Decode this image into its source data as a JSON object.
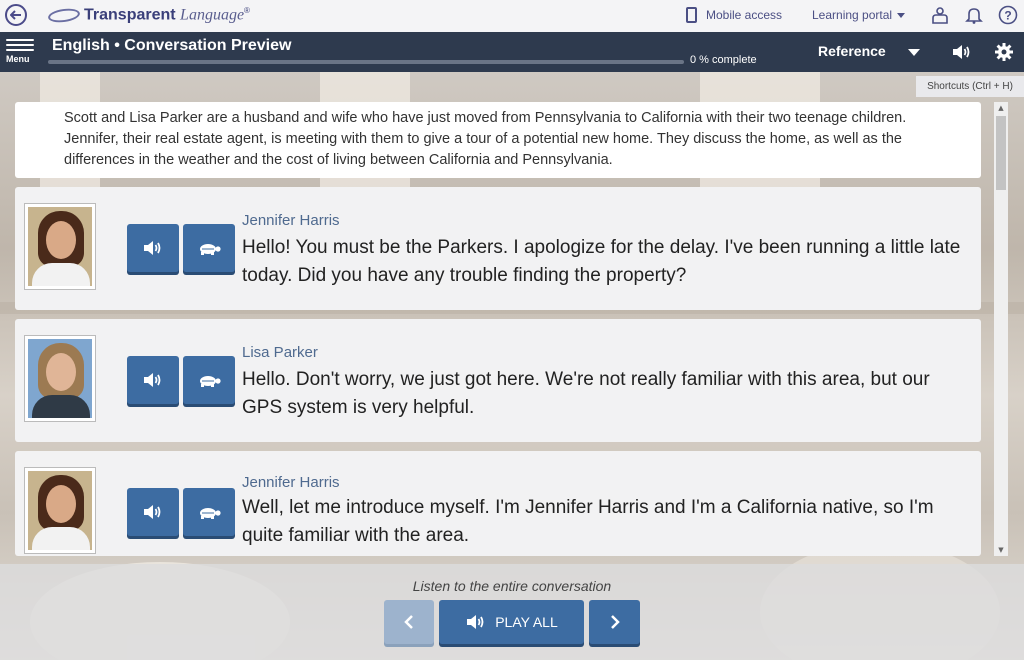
{
  "topbar": {
    "back_icon": "back-arrow-icon",
    "logo_brand": "Transparent",
    "logo_word": "Language",
    "logo_mark": "®",
    "mobile_access": "Mobile access",
    "learning_portal": "Learning portal",
    "icons": [
      "user-icon",
      "bell-icon",
      "help-icon"
    ]
  },
  "header": {
    "menu_label": "Menu",
    "title": "English • Conversation Preview",
    "progress_percent": 0,
    "progress_text": "0 % complete",
    "reference_label": "Reference",
    "icons": [
      "audio-icon",
      "settings-icon"
    ],
    "background_color": "#2e3a4e"
  },
  "shortcuts_label": "Shortcuts (Ctrl + H)",
  "intro_text": "Scott and Lisa Parker are a husband and wife who have just moved from Pennsylvania to California with their two teenage children. Jennifer, their real estate agent, is meeting with them to give a tour of a potential new home. They discuss the home, as well as the differences in the weather and the cost of living between California and Pennsylvania.",
  "lines": [
    {
      "speaker": "Jennifer Harris",
      "text": "Hello! You must be the Parkers. I apologize for the delay. I've been running a little late today. Did you have any trouble finding the property?"
    },
    {
      "speaker": "Lisa Parker",
      "text": "Hello. Don't worry, we just got here. We're not really familiar with this area, but our GPS system is very helpful."
    },
    {
      "speaker": "Jennifer Harris",
      "text": "Well, let me introduce myself. I'm Jennifer Harris and I'm a California native, so I'm quite familiar with the area."
    }
  ],
  "footer": {
    "caption": "Listen to the entire conversation",
    "play_all_label": "PLAY ALL",
    "prev_disabled": true
  },
  "colors": {
    "button_blue": "#3d6ca2",
    "speaker_name": "#4f6a8f"
  }
}
